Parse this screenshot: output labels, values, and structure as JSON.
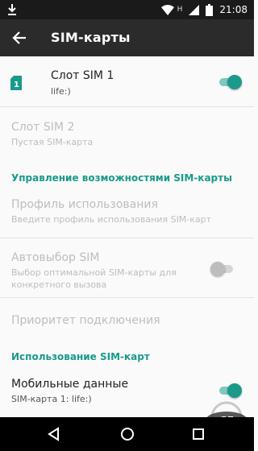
{
  "status_bar": {
    "network_letter": "H",
    "time": "21:08"
  },
  "app_bar": {
    "title": "SIM-карты"
  },
  "sim_slot_1": {
    "title": "Слот SIM 1",
    "subtitle": "life:)",
    "icon_label": "1",
    "enabled": true
  },
  "sim_slot_2": {
    "title": "Слот SIM 2",
    "subtitle": "Пустая SIM-карта"
  },
  "section_manage": {
    "label": "Управление возможностями SIM-карты"
  },
  "usage_profile": {
    "title": "Профиль использования",
    "subtitle": "Введите профиль использования SIM-карт"
  },
  "auto_select": {
    "title": "Автовыбор SIM",
    "subtitle_line1": "Выбор оптимальной SIM-карты для",
    "subtitle_line2": "конкретного вызова",
    "enabled": false
  },
  "connection_priority": {
    "title": "Приоритет подключения"
  },
  "section_usage": {
    "label": "Использование SIM-карт"
  },
  "mobile_data": {
    "title": "Мобильные данные",
    "subtitle": "SIM-карта 1: life:)",
    "enabled": true
  },
  "colors": {
    "accent": "#1a9a8a",
    "app_bar": "#2b2b2b",
    "status_bar": "#1a1a1a"
  }
}
